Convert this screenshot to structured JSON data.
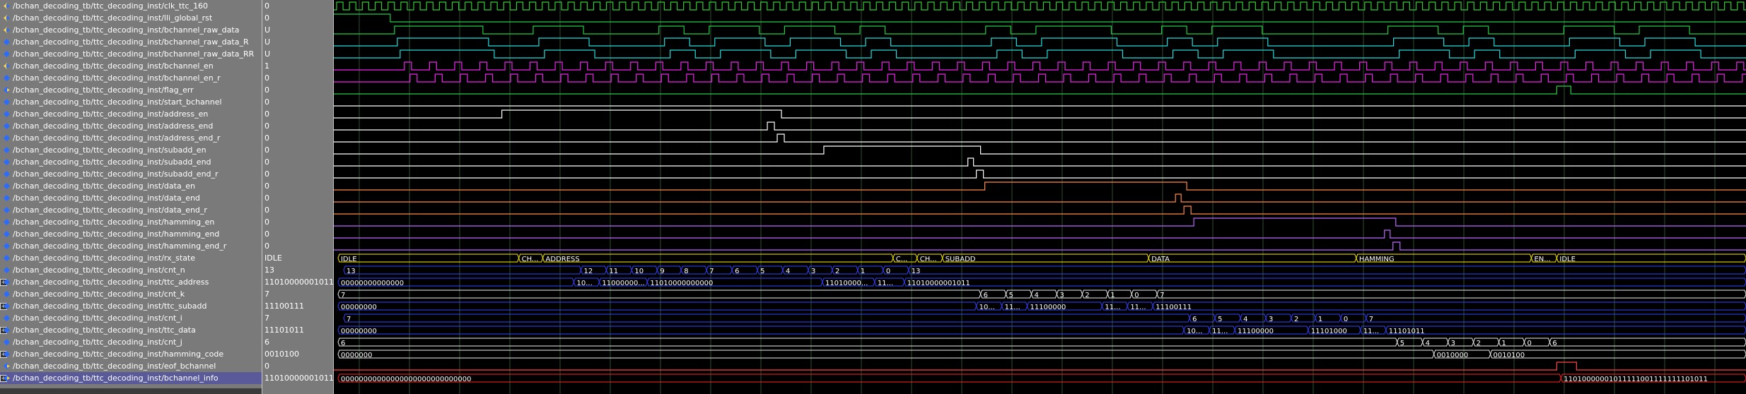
{
  "signals": [
    {
      "name": "/bchan_decoding_tb/ttc_decoding_inst/clk_ttc_160",
      "value": "0",
      "icon": "input-port-icon"
    },
    {
      "name": "/bchan_decoding_tb/ttc_decoding_inst/lli_global_rst",
      "value": "0",
      "icon": "input-port-icon"
    },
    {
      "name": "/bchan_decoding_tb/ttc_decoding_inst/bchannel_raw_data",
      "value": "U",
      "icon": "input-port-icon"
    },
    {
      "name": "/bchan_decoding_tb/ttc_decoding_inst/bchannel_raw_data_R",
      "value": "U",
      "icon": "signal-icon"
    },
    {
      "name": "/bchan_decoding_tb/ttc_decoding_inst/bchannel_raw_data_RR",
      "value": "U",
      "icon": "signal-icon"
    },
    {
      "name": "/bchan_decoding_tb/ttc_decoding_inst/bchannel_en",
      "value": "1",
      "icon": "input-port-icon"
    },
    {
      "name": "/bchan_decoding_tb/ttc_decoding_inst/bchannel_en_r",
      "value": "0",
      "icon": "signal-icon"
    },
    {
      "name": "/bchan_decoding_tb/ttc_decoding_inst/flag_err",
      "value": "0",
      "icon": "output-port-icon"
    },
    {
      "name": "/bchan_decoding_tb/ttc_decoding_inst/start_bchannel",
      "value": "0",
      "icon": "signal-icon"
    },
    {
      "name": "/bchan_decoding_tb/ttc_decoding_inst/address_en",
      "value": "0",
      "icon": "signal-icon"
    },
    {
      "name": "/bchan_decoding_tb/ttc_decoding_inst/address_end",
      "value": "0",
      "icon": "signal-icon"
    },
    {
      "name": "/bchan_decoding_tb/ttc_decoding_inst/address_end_r",
      "value": "0",
      "icon": "signal-icon"
    },
    {
      "name": "/bchan_decoding_tb/ttc_decoding_inst/subadd_en",
      "value": "0",
      "icon": "signal-icon"
    },
    {
      "name": "/bchan_decoding_tb/ttc_decoding_inst/subadd_end",
      "value": "0",
      "icon": "signal-icon"
    },
    {
      "name": "/bchan_decoding_tb/ttc_decoding_inst/subadd_end_r",
      "value": "0",
      "icon": "signal-icon"
    },
    {
      "name": "/bchan_decoding_tb/ttc_decoding_inst/data_en",
      "value": "0",
      "icon": "signal-icon"
    },
    {
      "name": "/bchan_decoding_tb/ttc_decoding_inst/data_end",
      "value": "0",
      "icon": "signal-icon"
    },
    {
      "name": "/bchan_decoding_tb/ttc_decoding_inst/data_end_r",
      "value": "0",
      "icon": "signal-icon"
    },
    {
      "name": "/bchan_decoding_tb/ttc_decoding_inst/hamming_en",
      "value": "0",
      "icon": "signal-icon"
    },
    {
      "name": "/bchan_decoding_tb/ttc_decoding_inst/hamming_end",
      "value": "0",
      "icon": "signal-icon"
    },
    {
      "name": "/bchan_decoding_tb/ttc_decoding_inst/hamming_end_r",
      "value": "0",
      "icon": "signal-icon"
    },
    {
      "name": "/bchan_decoding_tb/ttc_decoding_inst/rx_state",
      "value": "IDLE",
      "icon": "signal-icon"
    },
    {
      "name": "/bchan_decoding_tb/ttc_decoding_inst/cnt_n",
      "value": "13",
      "icon": "signal-icon"
    },
    {
      "name": "/bchan_decoding_tb/ttc_decoding_inst/ttc_address",
      "value": "11010000001011",
      "icon": "signal-icon",
      "expand": true
    },
    {
      "name": "/bchan_decoding_tb/ttc_decoding_inst/cnt_k",
      "value": "7",
      "icon": "signal-icon"
    },
    {
      "name": "/bchan_decoding_tb/ttc_decoding_inst/ttc_subadd",
      "value": "11100111",
      "icon": "signal-icon",
      "expand": true
    },
    {
      "name": "/bchan_decoding_tb/ttc_decoding_inst/cnt_i",
      "value": "7",
      "icon": "signal-icon"
    },
    {
      "name": "/bchan_decoding_tb/ttc_decoding_inst/ttc_data",
      "value": "11101011",
      "icon": "signal-icon",
      "expand": true
    },
    {
      "name": "/bchan_decoding_tb/ttc_decoding_inst/cnt_j",
      "value": "6",
      "icon": "signal-icon"
    },
    {
      "name": "/bchan_decoding_tb/ttc_decoding_inst/hamming_code",
      "value": "0010100",
      "icon": "signal-icon",
      "expand": true
    },
    {
      "name": "/bchan_decoding_tb/ttc_decoding_inst/eof_bchannel",
      "value": "0",
      "icon": "output-port-icon"
    },
    {
      "name": "/bchan_decoding_tb/ttc_decoding_inst/bchannel_info",
      "value": "11010000001011...",
      "icon": "output-port-icon",
      "expand": true
    }
  ],
  "bus_labels": {
    "rx_state": [
      {
        "x": 0.003,
        "t": "IDLE"
      },
      {
        "x": 0.131,
        "t": "CH..."
      },
      {
        "x": 0.148,
        "t": "ADDRESS"
      },
      {
        "x": 0.396,
        "t": "C..."
      },
      {
        "x": 0.413,
        "t": "CH..."
      },
      {
        "x": 0.431,
        "t": "SUBADD"
      },
      {
        "x": 0.577,
        "t": "DATA"
      },
      {
        "x": 0.724,
        "t": "HAMMING"
      },
      {
        "x": 0.848,
        "t": "EN..."
      },
      {
        "x": 0.866,
        "t": "IDLE"
      }
    ],
    "cnt_n": [
      {
        "x": 0.007,
        "t": "13"
      },
      {
        "x": 0.175,
        "t": "12"
      },
      {
        "x": 0.193,
        "t": "11"
      },
      {
        "x": 0.211,
        "t": "10"
      },
      {
        "x": 0.229,
        "t": "9"
      },
      {
        "x": 0.246,
        "t": "8"
      },
      {
        "x": 0.264,
        "t": "7"
      },
      {
        "x": 0.282,
        "t": "6"
      },
      {
        "x": 0.3,
        "t": "5"
      },
      {
        "x": 0.318,
        "t": "4"
      },
      {
        "x": 0.336,
        "t": "3"
      },
      {
        "x": 0.353,
        "t": "2"
      },
      {
        "x": 0.371,
        "t": "1"
      },
      {
        "x": 0.389,
        "t": "0"
      },
      {
        "x": 0.407,
        "t": "13"
      }
    ],
    "ttc_address": [
      {
        "x": 0.003,
        "t": "00000000000000"
      },
      {
        "x": 0.17,
        "t": "10..."
      },
      {
        "x": 0.188,
        "t": "11000000..."
      },
      {
        "x": 0.222,
        "t": "11010000000000"
      },
      {
        "x": 0.346,
        "t": "11010000..."
      },
      {
        "x": 0.383,
        "t": "11..."
      },
      {
        "x": 0.404,
        "t": "11010000001011"
      }
    ],
    "cnt_k": [
      {
        "x": 0.003,
        "t": "7"
      },
      {
        "x": 0.458,
        "t": "6"
      },
      {
        "x": 0.476,
        "t": "5"
      },
      {
        "x": 0.494,
        "t": "4"
      },
      {
        "x": 0.512,
        "t": "3"
      },
      {
        "x": 0.53,
        "t": "2"
      },
      {
        "x": 0.548,
        "t": "1"
      },
      {
        "x": 0.565,
        "t": "0"
      },
      {
        "x": 0.583,
        "t": "7"
      }
    ],
    "ttc_subadd": [
      {
        "x": 0.003,
        "t": "00000000"
      },
      {
        "x": 0.455,
        "t": "10..."
      },
      {
        "x": 0.473,
        "t": "11..."
      },
      {
        "x": 0.491,
        "t": "11100000"
      },
      {
        "x": 0.544,
        "t": "11..."
      },
      {
        "x": 0.562,
        "t": "11..."
      },
      {
        "x": 0.58,
        "t": "11100111"
      }
    ],
    "cnt_i": [
      {
        "x": 0.007,
        "t": "7"
      },
      {
        "x": 0.606,
        "t": "6"
      },
      {
        "x": 0.624,
        "t": "5"
      },
      {
        "x": 0.642,
        "t": "4"
      },
      {
        "x": 0.66,
        "t": "3"
      },
      {
        "x": 0.678,
        "t": "2"
      },
      {
        "x": 0.695,
        "t": "1"
      },
      {
        "x": 0.713,
        "t": "0"
      },
      {
        "x": 0.731,
        "t": "7"
      }
    ],
    "ttc_data": [
      {
        "x": 0.003,
        "t": "00000000"
      },
      {
        "x": 0.602,
        "t": "10..."
      },
      {
        "x": 0.62,
        "t": "11..."
      },
      {
        "x": 0.638,
        "t": "11100000"
      },
      {
        "x": 0.69,
        "t": "11101000"
      },
      {
        "x": 0.727,
        "t": "11..."
      },
      {
        "x": 0.745,
        "t": "11101011"
      }
    ],
    "cnt_j": [
      {
        "x": 0.003,
        "t": "6"
      },
      {
        "x": 0.753,
        "t": "5"
      },
      {
        "x": 0.771,
        "t": "4"
      },
      {
        "x": 0.789,
        "t": "3"
      },
      {
        "x": 0.807,
        "t": "2"
      },
      {
        "x": 0.825,
        "t": "1"
      },
      {
        "x": 0.843,
        "t": "0"
      },
      {
        "x": 0.861,
        "t": "6"
      }
    ],
    "hamming_code": [
      {
        "x": 0.003,
        "t": "0000000"
      },
      {
        "x": 0.779,
        "t": "0010000"
      },
      {
        "x": 0.819,
        "t": "0010100"
      }
    ],
    "bchannel_info": [
      {
        "x": 0.003,
        "t": "00000000000000000000000000000"
      },
      {
        "x": 0.869,
        "t": "11010000001011111001111111101011"
      }
    ]
  },
  "colors": {
    "clock": "#33cc33",
    "green": "#22cc44",
    "cyan": "#22dddd",
    "magenta": "#ee22ee",
    "white": "#ffffff",
    "orange": "#ff8844",
    "purple": "#bb66ff",
    "bus_yellow": "#ffee00",
    "bus_blue": "#3344ff",
    "bus_white": "#eeeeee",
    "bus_red": "#ff2222",
    "grid": "#2f4f2f"
  }
}
